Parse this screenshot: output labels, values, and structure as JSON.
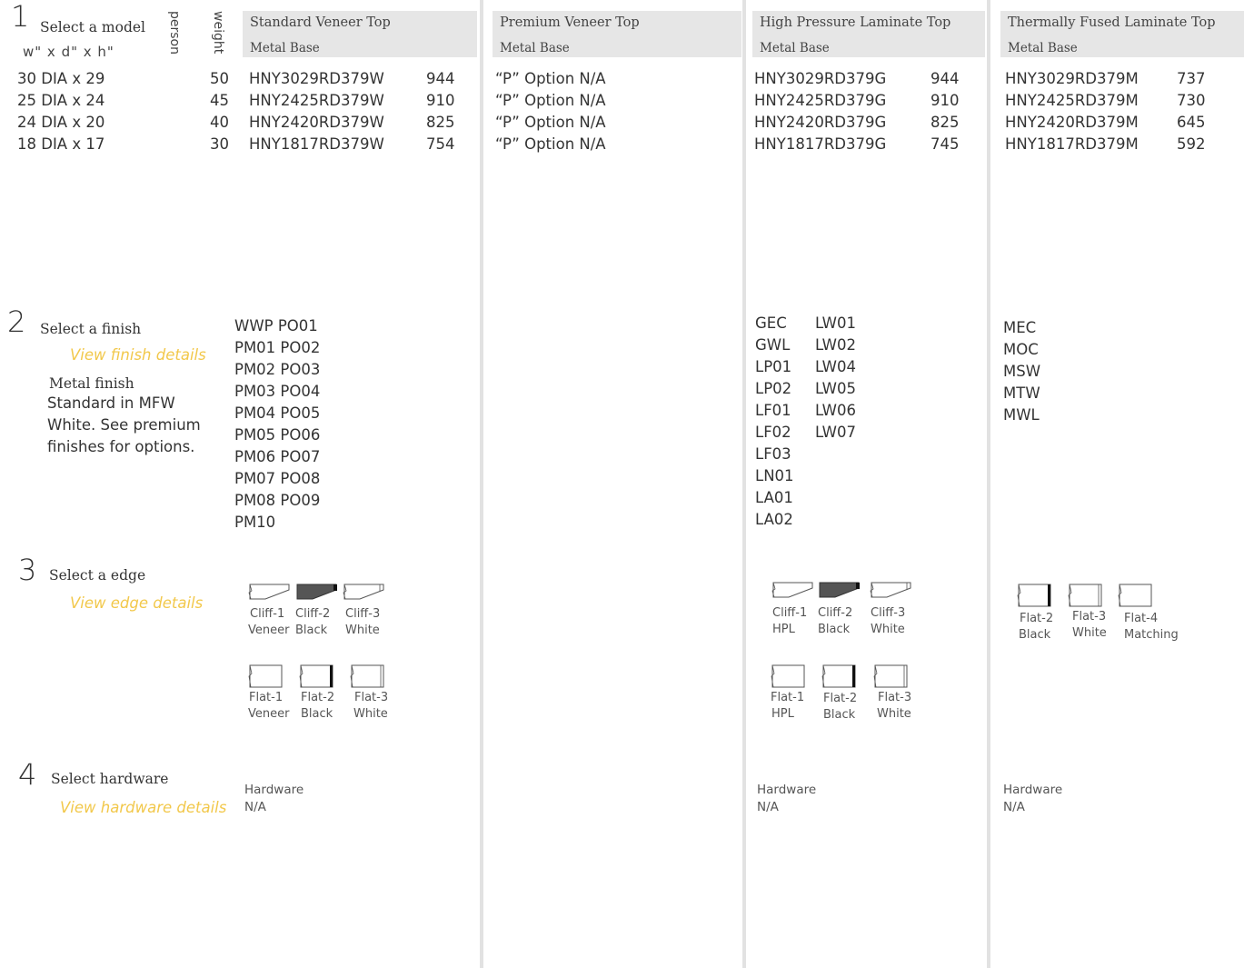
{
  "step1": {
    "number": "1",
    "title": "Select a model",
    "dims_label": "w\" x d\" x h\"",
    "person_label": "person",
    "weight_label": "weight",
    "models": [
      {
        "size": "30 DIA x 29",
        "weight": "50"
      },
      {
        "size": "25 DIA x 24",
        "weight": "45"
      },
      {
        "size": "24 DIA x 20",
        "weight": "40"
      },
      {
        "size": "18 DIA x 17",
        "weight": "30"
      }
    ]
  },
  "columns": [
    {
      "top": "Standard Veneer Top",
      "base": "Metal Base",
      "rows": [
        {
          "code": "HNY3029RD379W",
          "price": "944"
        },
        {
          "code": "HNY2425RD379W",
          "price": "910"
        },
        {
          "code": "HNY2420RD379W",
          "price": "825"
        },
        {
          "code": "HNY1817RD379W",
          "price": "754"
        }
      ]
    },
    {
      "top": "Premium Veneer Top",
      "base": "Metal Base",
      "rows": [
        {
          "code": "“P” Option N/A",
          "price": ""
        },
        {
          "code": "“P” Option N/A",
          "price": ""
        },
        {
          "code": "“P” Option N/A",
          "price": ""
        },
        {
          "code": "“P” Option N/A",
          "price": ""
        }
      ]
    },
    {
      "top": "High Pressure Laminate Top",
      "base": "Metal Base",
      "rows": [
        {
          "code": "HNY3029RD379G",
          "price": "944"
        },
        {
          "code": "HNY2425RD379G",
          "price": "910"
        },
        {
          "code": "HNY2420RD379G",
          "price": "825"
        },
        {
          "code": "HNY1817RD379G",
          "price": "745"
        }
      ]
    },
    {
      "top": "Thermally Fused Laminate Top",
      "base": "Metal Base",
      "rows": [
        {
          "code": "HNY3029RD379M",
          "price": "737"
        },
        {
          "code": "HNY2425RD379M",
          "price": "730"
        },
        {
          "code": "HNY2420RD379M",
          "price": "645"
        },
        {
          "code": "HNY1817RD379M",
          "price": "592"
        }
      ]
    }
  ],
  "step2": {
    "number": "2",
    "title": "Select a finish",
    "link": "View finish details",
    "metal_title": "Metal finish",
    "metal_text": [
      "Standard in MFW",
      "White. See premium",
      "finishes for options."
    ],
    "veneer_finishes": [
      "WWP PO01",
      "PM01 PO02",
      "PM02 PO03",
      "PM03 PO04",
      "PM04 PO05",
      "PM05 PO06",
      "PM06 PO07",
      "PM07 PO08",
      "PM08 PO09",
      "PM10"
    ],
    "hpl_finishes_col1": [
      "GEC",
      "GWL",
      "LP01",
      "LP02",
      "LF01",
      "LF02",
      "LF03",
      "LN01",
      "LA01",
      "LA02"
    ],
    "hpl_finishes_col2": [
      "LW01",
      "LW02",
      "LW04",
      "LW05",
      "LW06",
      "LW07"
    ],
    "tfl_finishes": [
      "MEC",
      "MOC",
      "MSW",
      "MTW",
      "MWL"
    ]
  },
  "step3": {
    "number": "3",
    "title": "Select a edge",
    "link": "View edge details",
    "veneer_cliff": [
      {
        "name": "Cliff-1",
        "sub": "Veneer",
        "icon": "cliff-edge-icon"
      },
      {
        "name": "Cliff-2",
        "sub": "Black",
        "icon": "cliff-edge-black-icon"
      },
      {
        "name": "Cliff-3",
        "sub": "White",
        "icon": "cliff-edge-white-icon"
      }
    ],
    "veneer_flat": [
      {
        "name": "Flat-1",
        "sub": "Veneer",
        "icon": "flat-edge-icon"
      },
      {
        "name": "Flat-2",
        "sub": "Black",
        "icon": "flat-edge-black-icon"
      },
      {
        "name": "Flat-3",
        "sub": "White",
        "icon": "flat-edge-white-icon"
      }
    ],
    "hpl_cliff": [
      {
        "name": "Cliff-1",
        "sub": "HPL",
        "icon": "cliff-edge-icon"
      },
      {
        "name": "Cliff-2",
        "sub": "Black",
        "icon": "cliff-edge-black-icon"
      },
      {
        "name": "Cliff-3",
        "sub": "White",
        "icon": "cliff-edge-white-icon"
      }
    ],
    "hpl_flat": [
      {
        "name": "Flat-1",
        "sub": "HPL",
        "icon": "flat-edge-icon"
      },
      {
        "name": "Flat-2",
        "sub": "Black",
        "icon": "flat-edge-black-icon"
      },
      {
        "name": "Flat-3",
        "sub": "White",
        "icon": "flat-edge-white-icon"
      }
    ],
    "tfl_flat": [
      {
        "name": "Flat-2",
        "sub": "Black",
        "icon": "flat-edge-black-icon"
      },
      {
        "name": "Flat-3",
        "sub": "White",
        "icon": "flat-edge-white-icon"
      },
      {
        "name": "Flat-4",
        "sub": "Matching",
        "icon": "flat-edge-icon"
      }
    ]
  },
  "step4": {
    "number": "4",
    "title": "Select hardware",
    "link": "View hardware details",
    "hardware_label": "Hardware",
    "hardware_value": "N/A"
  },
  "colors": {
    "link": "#f2c84b",
    "header_bg": "#e6e6e6",
    "divider": "#e2e2e2",
    "black_edge": "#555555"
  }
}
